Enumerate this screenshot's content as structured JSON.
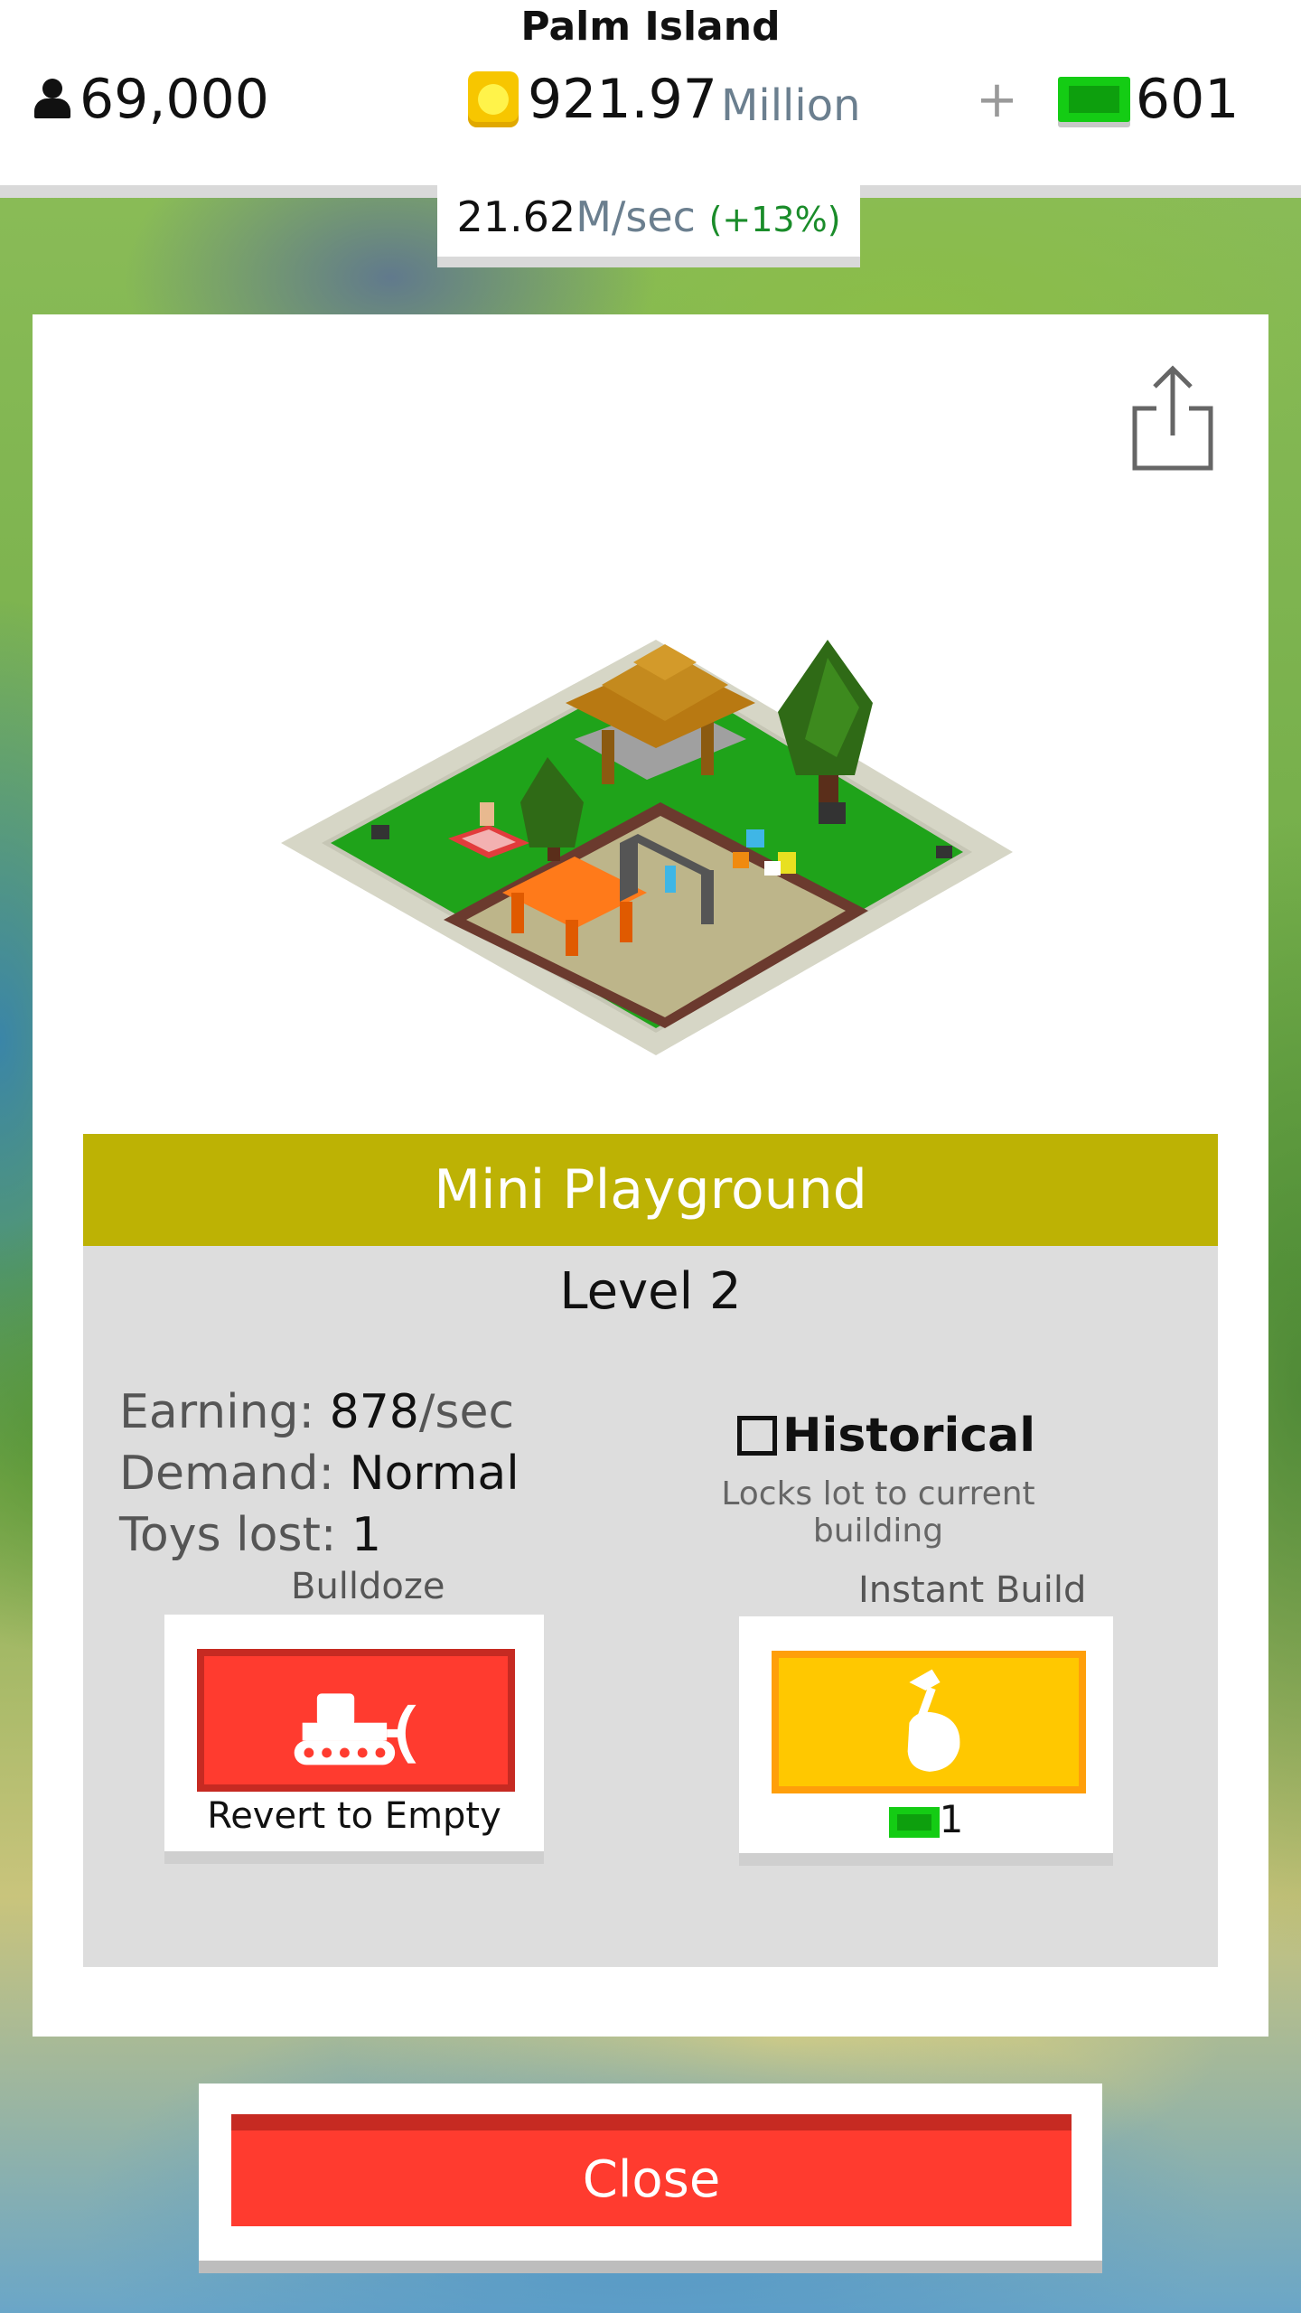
{
  "hud": {
    "island_name": "Palm Island",
    "population": "69,000",
    "money_value": "921.97",
    "money_unit": "Million",
    "plus": "+",
    "gems": "601",
    "rate_value": "21.62",
    "rate_unit": "M/sec",
    "rate_bonus": "(+13%)"
  },
  "building": {
    "name": "Mini Playground",
    "level": "Level 2",
    "earning_label": "Earning:",
    "earning_value": "878",
    "earning_unit": "/sec",
    "demand_label": "Demand:",
    "demand_value": "Normal",
    "toys_label": "Toys lost:",
    "toys_value": "1",
    "historical_label": "Historical",
    "historical_checked": false,
    "historical_sub": "Locks lot to current building"
  },
  "actions": {
    "bulldoze_label": "Bulldoze",
    "bulldoze_button_text": "Revert to Empty",
    "instant_build_label": "Instant Build",
    "instant_build_cost": "1"
  },
  "footer": {
    "close_label": "Close"
  },
  "icons": [
    "person-icon",
    "coin-icon",
    "gem-icon",
    "share-icon",
    "bulldozer-icon",
    "hammer-hand-icon",
    "checkbox-icon"
  ],
  "colors": {
    "title_bar": "#bdb204",
    "close_red": "#ff3b2f",
    "build_yellow": "#ffc800",
    "gem_green": "#14cc14",
    "bonus_green": "#1a8c2a"
  }
}
